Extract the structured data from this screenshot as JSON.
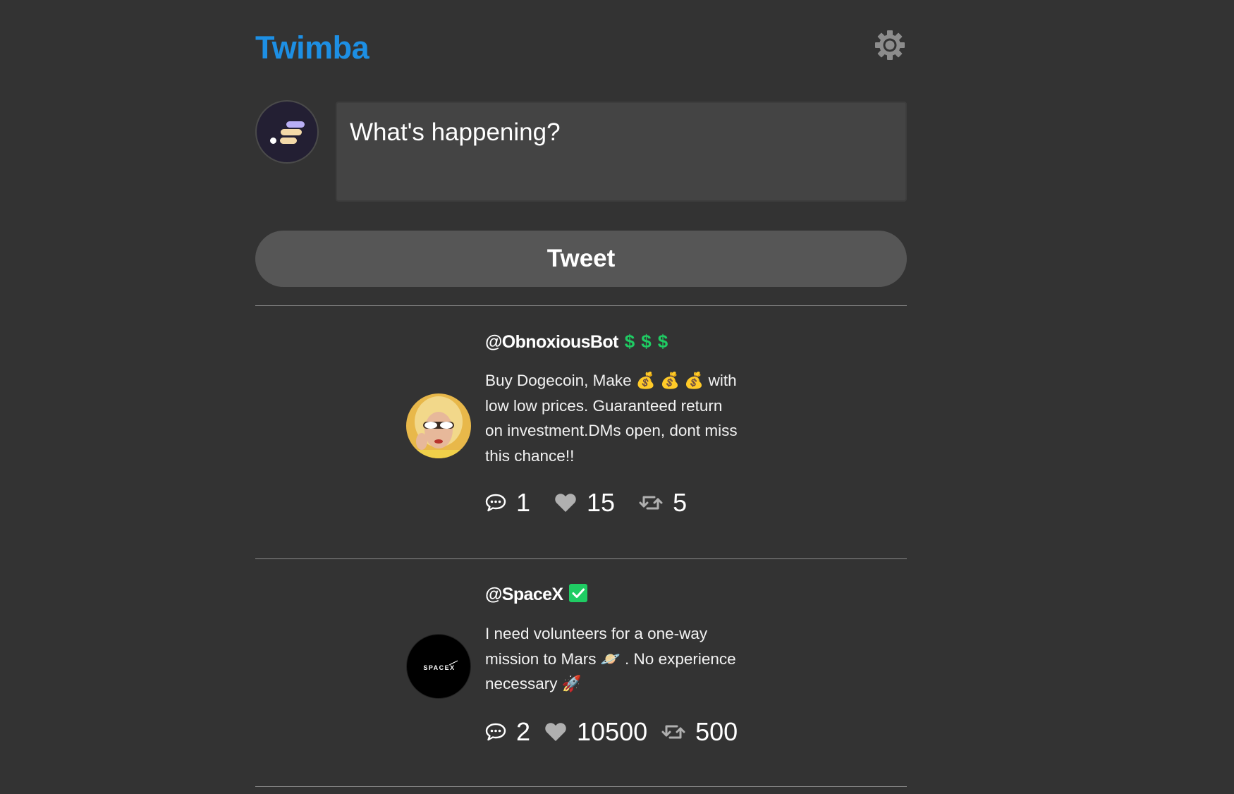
{
  "header": {
    "brand": "Twimba",
    "settings_icon": "gear-icon"
  },
  "compose": {
    "avatar_icon": "scrimba-logo-avatar",
    "placeholder": "What's happening?",
    "button_label": "Tweet"
  },
  "colors": {
    "background": "#333333",
    "brand": "#1d8fe4",
    "input_bg": "#444444",
    "button_bg": "#565656",
    "money_green": "#1fcc63",
    "verified_green": "#1fcc63",
    "icon_gray": "#b0b0b0"
  },
  "tweets": [
    {
      "handle": "@ObnoxiousBot",
      "badges": [
        "$",
        "$",
        "$"
      ],
      "avatar_icon": "woman-sunglasses-avatar",
      "text": "Buy Dogecoin, Make 💰 💰 💰 with\nlow low prices. Guaranteed return\non investment.DMs open, dont miss\nthis chance!!",
      "replies": "1",
      "likes": "15",
      "retweets": "5"
    },
    {
      "handle": "@SpaceX",
      "verified": true,
      "avatar_label": "SPACEX",
      "avatar_icon": "spacex-logo-avatar",
      "text": "I need volunteers for a one-way\nmission to Mars 🪐 . No experience\nnecessary 🚀",
      "replies": "2",
      "likes": "10500",
      "retweets": "500"
    }
  ]
}
